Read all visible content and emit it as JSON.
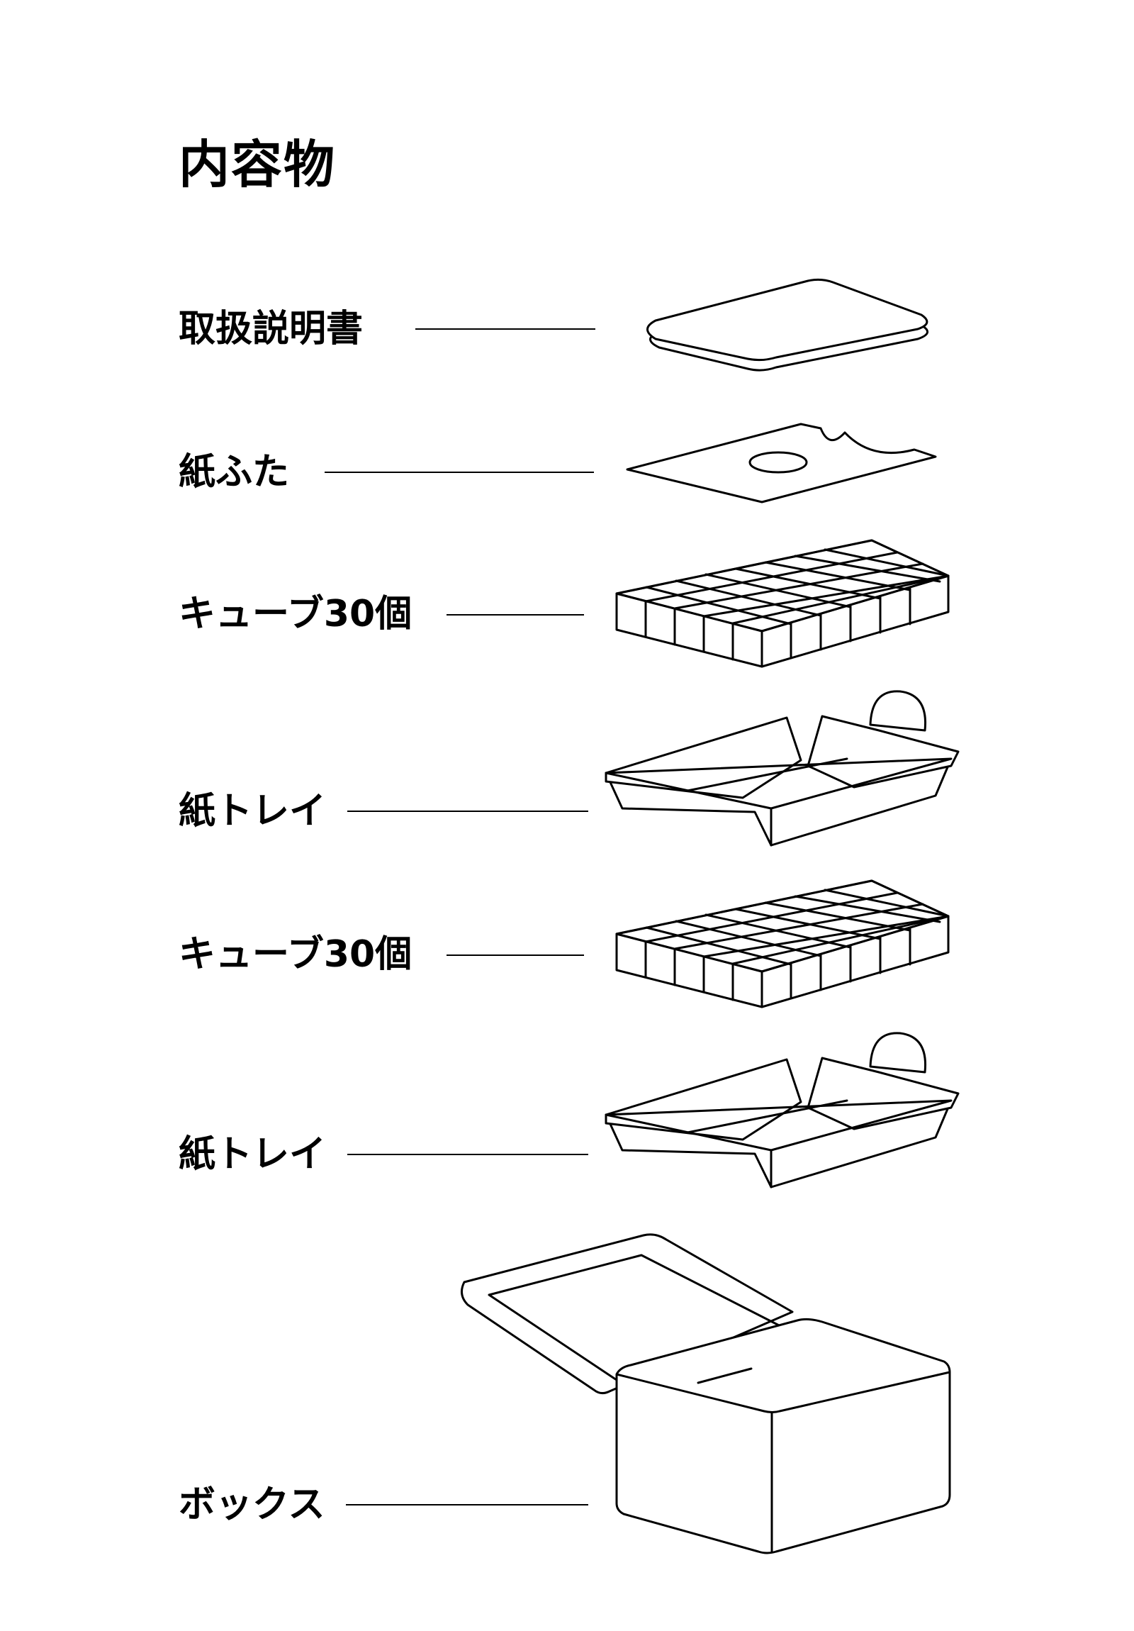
{
  "page": {
    "title": "内容物"
  },
  "items": [
    {
      "label": "取扱説明書",
      "icon": "manual-icon"
    },
    {
      "label": "紙ふた",
      "icon": "paper-lid-icon"
    },
    {
      "label": "キューブ30個",
      "icon": "cube-grid-icon"
    },
    {
      "label": "紙トレイ",
      "icon": "paper-tray-icon"
    },
    {
      "label": "キューブ30個",
      "icon": "cube-grid-icon"
    },
    {
      "label": "紙トレイ",
      "icon": "paper-tray-icon"
    },
    {
      "label": "ボックス",
      "icon": "box-icon"
    }
  ],
  "colors": {
    "ink": "#000000",
    "background": "#ffffff"
  }
}
